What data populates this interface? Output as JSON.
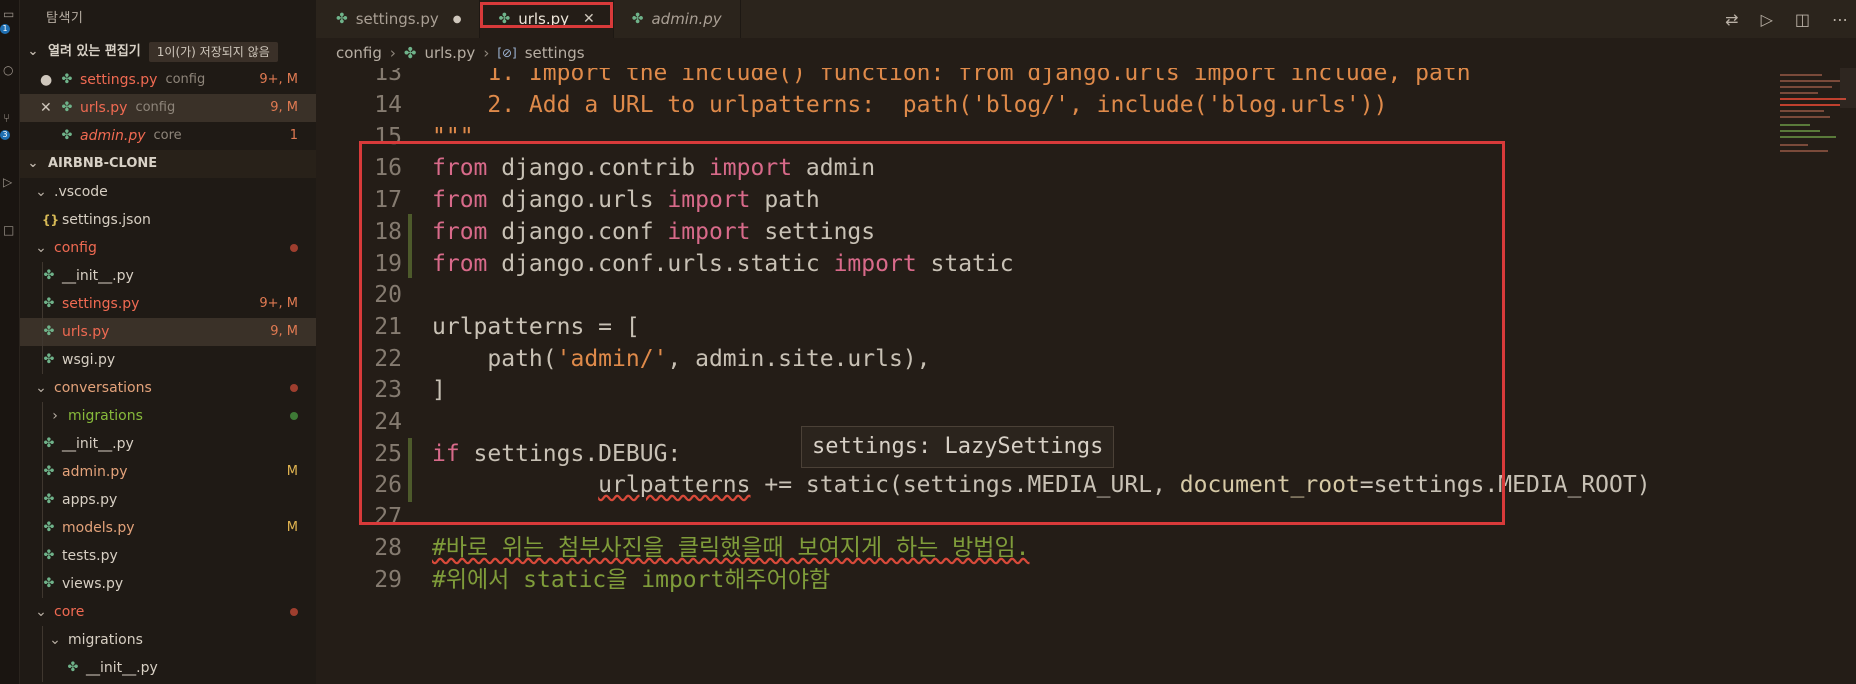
{
  "activity_bar": {
    "badges": [
      "1",
      "3"
    ]
  },
  "sidebar": {
    "title": "탐색기",
    "open_editors": {
      "label": "열려 있는 편집기",
      "badge": "1이(가) 저장되지 않음",
      "items": [
        {
          "name": "settings.py",
          "folder": "config",
          "status": "9+, M",
          "state": "dirty"
        },
        {
          "name": "urls.py",
          "folder": "config",
          "status": "9, M",
          "state": "close"
        },
        {
          "name": "admin.py",
          "folder": "core",
          "status": "1",
          "state": "none"
        }
      ]
    },
    "workspace": "AIRBNB-CLONE",
    "tree": [
      {
        "label": ".vscode",
        "type": "folder",
        "depth": 0
      },
      {
        "label": "settings.json",
        "type": "json",
        "depth": 1
      },
      {
        "label": "config",
        "type": "folder",
        "depth": 0,
        "dot": "red"
      },
      {
        "label": "__init__.py",
        "type": "py",
        "depth": 1
      },
      {
        "label": "settings.py",
        "type": "py",
        "depth": 1,
        "badge": "9+, M",
        "color": "red"
      },
      {
        "label": "urls.py",
        "type": "py",
        "depth": 1,
        "badge": "9, M",
        "color": "red",
        "selected": true
      },
      {
        "label": "wsgi.py",
        "type": "py",
        "depth": 1
      },
      {
        "label": "conversations",
        "type": "folder",
        "depth": 0,
        "dot": "red"
      },
      {
        "label": "migrations",
        "type": "folder-closed",
        "depth": 1,
        "dot": "green",
        "color": "green"
      },
      {
        "label": "__init__.py",
        "type": "py",
        "depth": 1
      },
      {
        "label": "admin.py",
        "type": "py",
        "depth": 1,
        "badge": "M"
      },
      {
        "label": "apps.py",
        "type": "py",
        "depth": 1
      },
      {
        "label": "models.py",
        "type": "py",
        "depth": 1,
        "badge": "M"
      },
      {
        "label": "tests.py",
        "type": "py",
        "depth": 1
      },
      {
        "label": "views.py",
        "type": "py",
        "depth": 1
      },
      {
        "label": "core",
        "type": "folder",
        "depth": 0,
        "dot": "red",
        "color": "red"
      },
      {
        "label": "migrations",
        "type": "folder",
        "depth": 1
      },
      {
        "label": "__init__.py",
        "type": "py",
        "depth": 2
      }
    ]
  },
  "tabs": [
    {
      "label": "settings.py",
      "modified": true
    },
    {
      "label": "urls.py",
      "active": true
    },
    {
      "label": "admin.py",
      "italic": true
    }
  ],
  "breadcrumb": {
    "folder": "config",
    "file": "urls.py",
    "symbol": "settings"
  },
  "editor": {
    "tooltip": "settings: LazySettings",
    "lines": [
      {
        "n": "13",
        "text": "    1. Import the include() function: from django.urls import include, path"
      },
      {
        "n": "14",
        "text": "    2. Add a URL to urlpatterns:  path('blog/', include('blog.urls'))"
      },
      {
        "n": "15",
        "text": "\"\"\""
      },
      {
        "n": "16",
        "kw1": "from",
        "mod": " django.contrib ",
        "kw2": "import",
        "rest": " admin"
      },
      {
        "n": "17",
        "kw1": "from",
        "mod": " django.urls ",
        "kw2": "import",
        "rest": " path"
      },
      {
        "n": "18",
        "kw1": "from",
        "mod": " django.conf ",
        "kw2": "import",
        "rest": " settings"
      },
      {
        "n": "19",
        "kw1": "from",
        "mod": " django.conf.urls.static ",
        "kw2": "import",
        "rest": " static"
      },
      {
        "n": "20",
        "text": ""
      },
      {
        "n": "21",
        "text": "urlpatterns = ["
      },
      {
        "n": "22",
        "pre": "    path(",
        "str": "'admin/'",
        "post": ", admin.site.urls),"
      },
      {
        "n": "23",
        "text": "]"
      },
      {
        "n": "24",
        "text": ""
      },
      {
        "n": "25",
        "kw1": "if",
        "rest": " settings.DEBUG:"
      },
      {
        "n": "26",
        "ind": "            ",
        "sq": "urlpatterns",
        "mid": " += static(settings.MEDIA_URL, ",
        "param": "document_root",
        "tail": "=settings.MEDIA_ROOT)"
      },
      {
        "n": "27",
        "text": ""
      },
      {
        "n": "28",
        "comment": "#바로 위는 첨부사진을 클릭했을때 보여지게 하는 방법임."
      },
      {
        "n": "29",
        "comment": "#위에서 static을 import해주어야함"
      }
    ]
  }
}
